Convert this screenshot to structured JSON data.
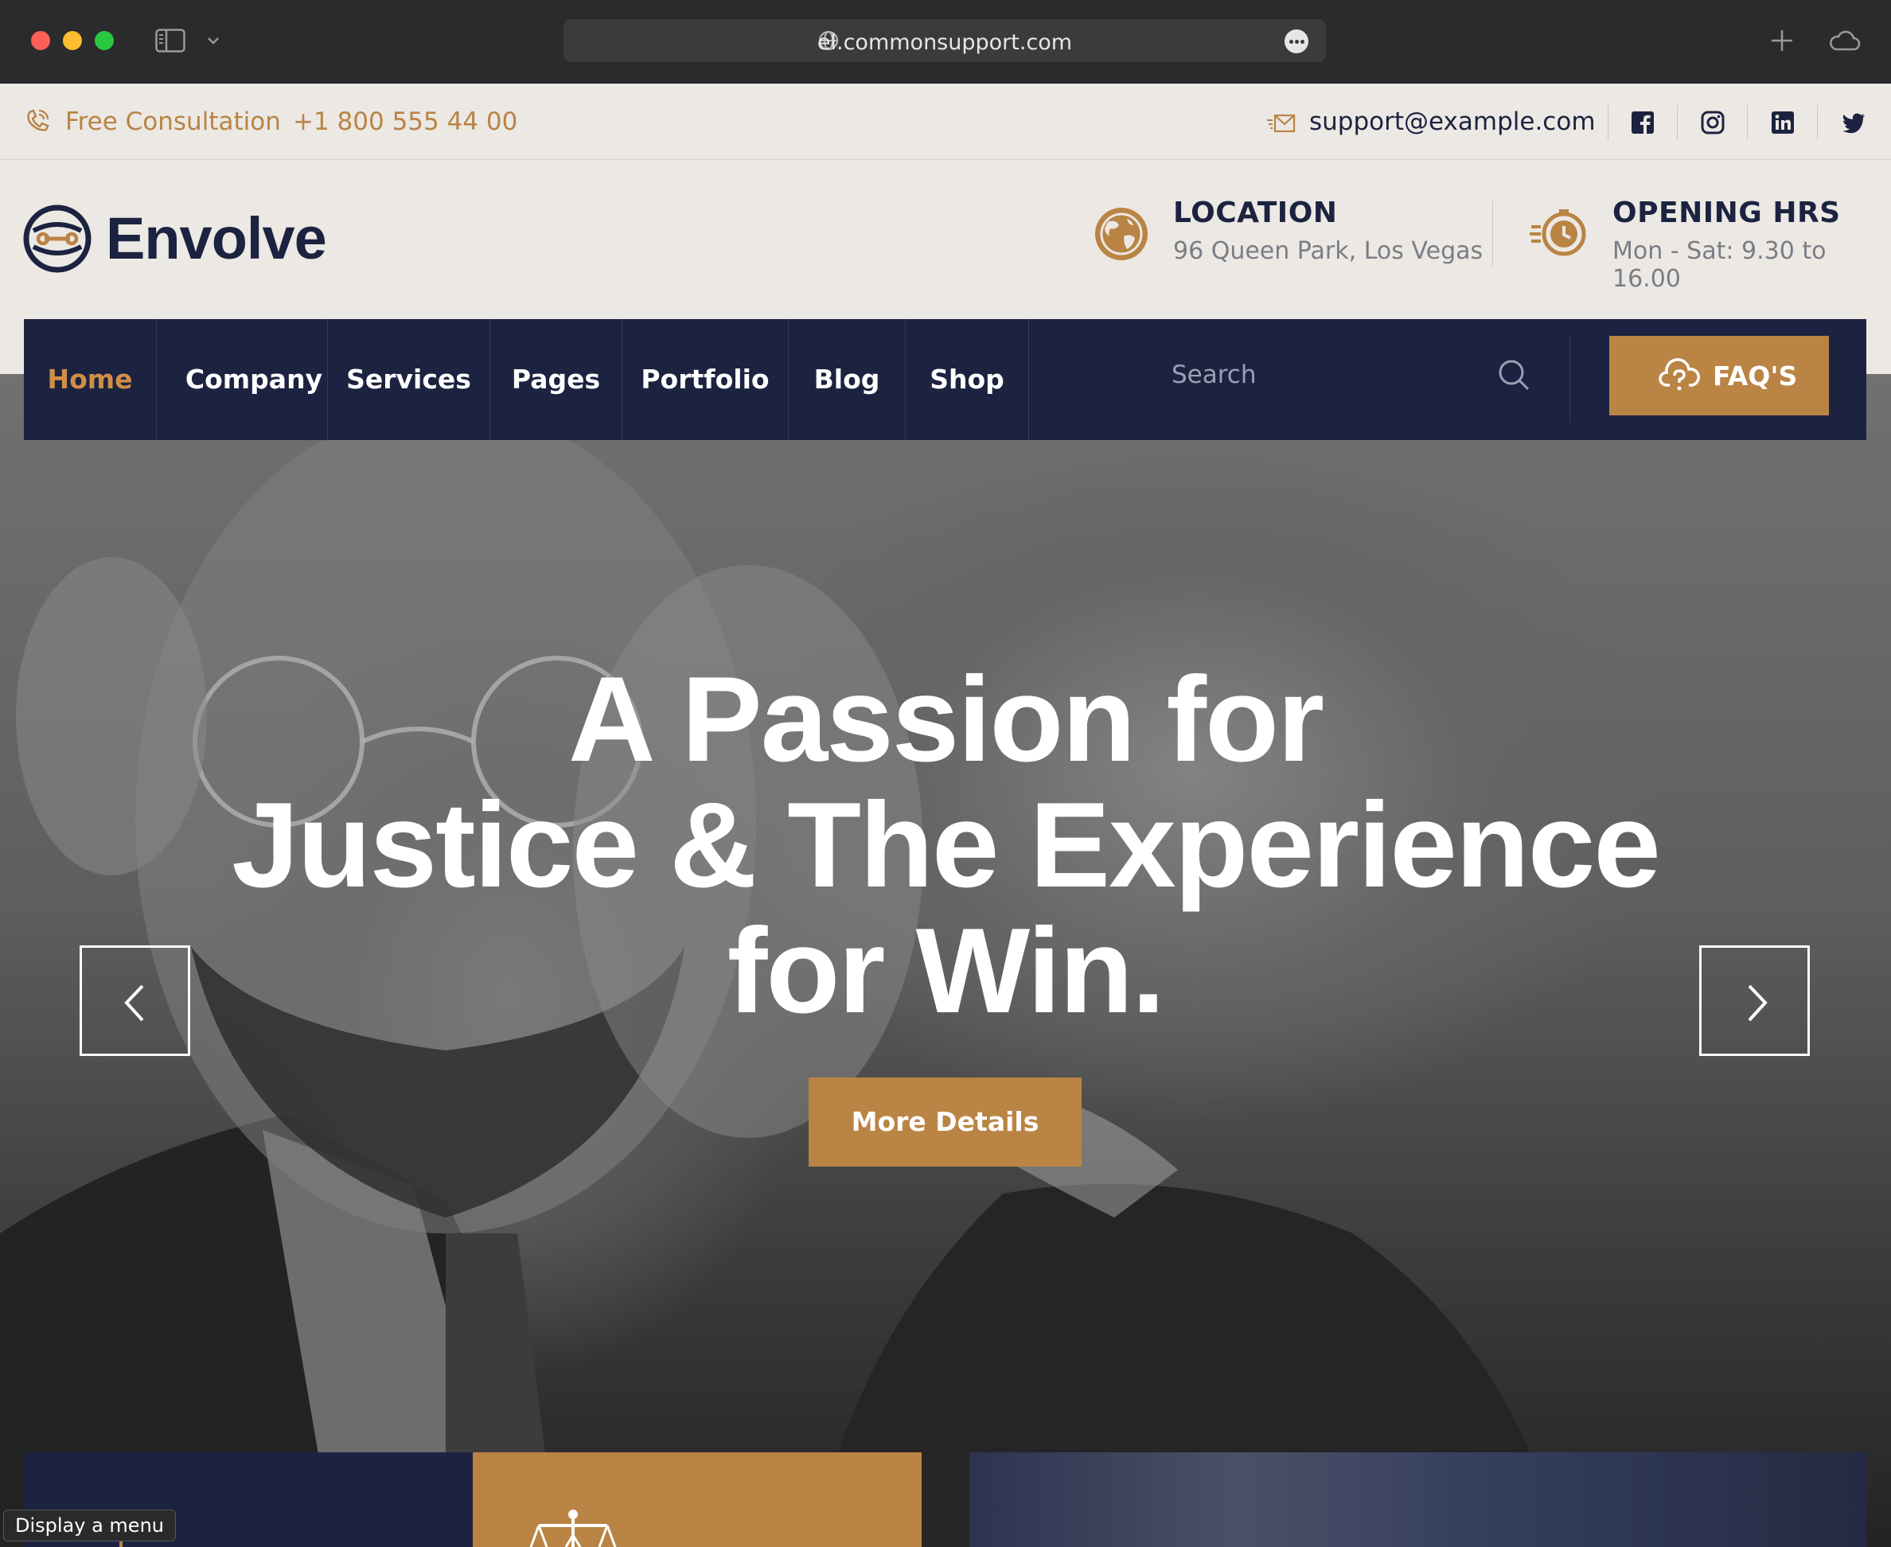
{
  "browser": {
    "url": "el.commonsupport.com"
  },
  "topbar": {
    "consultation_label": "Free Consultation",
    "phone": "+1 800 555 44 00",
    "email": "support@example.com",
    "social": [
      "facebook-icon",
      "instagram-icon",
      "linkedin-icon",
      "twitter-icon"
    ]
  },
  "header": {
    "logo_text": "Envolve",
    "location_title": "LOCATION",
    "location_value": "96 Queen Park, Los Vegas",
    "hours_title": "OPENING HRS",
    "hours_value": "Mon - Sat: 9.30 to 16.00"
  },
  "nav": {
    "items": [
      {
        "label": "Home",
        "active": true
      },
      {
        "label": "Company"
      },
      {
        "label": "Services"
      },
      {
        "label": "Pages"
      },
      {
        "label": "Portfolio"
      },
      {
        "label": "Blog"
      },
      {
        "label": "Shop"
      }
    ],
    "search_placeholder": "Search",
    "faq_label": "FAQ'S"
  },
  "hero": {
    "title_lines": [
      "A Passion for",
      "Justice & The Experience",
      "for Win."
    ],
    "button_label": "More Details"
  },
  "tooltip": "Display a menu",
  "colors": {
    "accent": "#b98444",
    "navy": "#1c2340",
    "cream": "#ece8e4"
  }
}
